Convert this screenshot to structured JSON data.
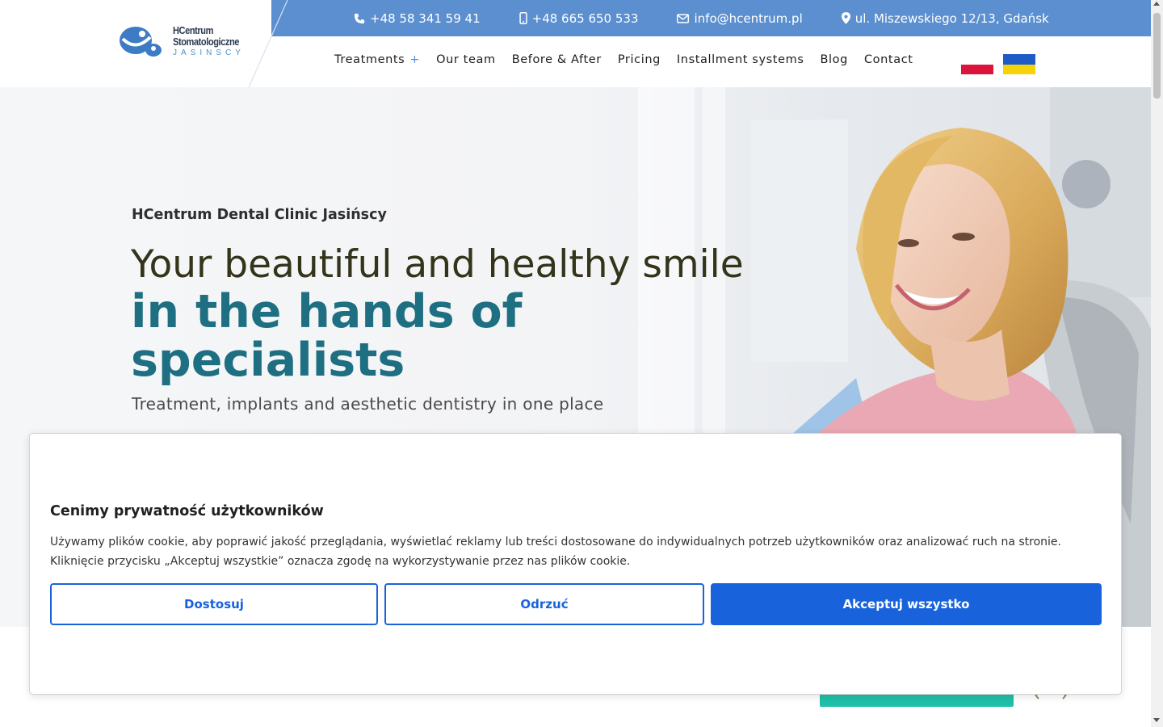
{
  "topbar": {
    "phone": "+48 58 341 59 41",
    "mobile": "+48 665 650 533",
    "email": "info@hcentrum.pl",
    "address": "ul. Miszewskiego 12/13, Gdańsk"
  },
  "logo": {
    "line1": "HCentrum",
    "line2": "Stomatologiczne",
    "line3": "JASINSCY"
  },
  "nav": {
    "items": [
      "Treatments",
      "Our team",
      "Before & After",
      "Pricing",
      "Installment systems",
      "Blog",
      "Contact"
    ],
    "treatments_plus": "+"
  },
  "hero": {
    "subtitle": "HCentrum Dental Clinic Jasińscy",
    "headline_line1": "Your beautiful and healthy smile",
    "headline_line2": "in the hands of specialists",
    "tagline": "Treatment, implants and aesthetic dentistry in one place"
  },
  "cookie": {
    "title": "Cenimy prywatność użytkowników",
    "text": "Używamy plików cookie, aby poprawić jakość przeglądania, wyświetlać reklamy lub treści dostosowane do indywidualnych potrzeb użytkowników oraz analizować ruch na stronie. Kliknięcie przycisku „Akceptuj wszystkie” oznacza zgodę na wykorzystywanie przez nas plików cookie.",
    "customize": "Dostosuj",
    "reject": "Odrzuć",
    "accept": "Akceptuj wszystko"
  },
  "colors": {
    "topbar": "#5b8fcf",
    "headline_accent": "#1e6f82",
    "cookie_primary": "#1863dc",
    "teal_button": "#1fbfa8"
  }
}
